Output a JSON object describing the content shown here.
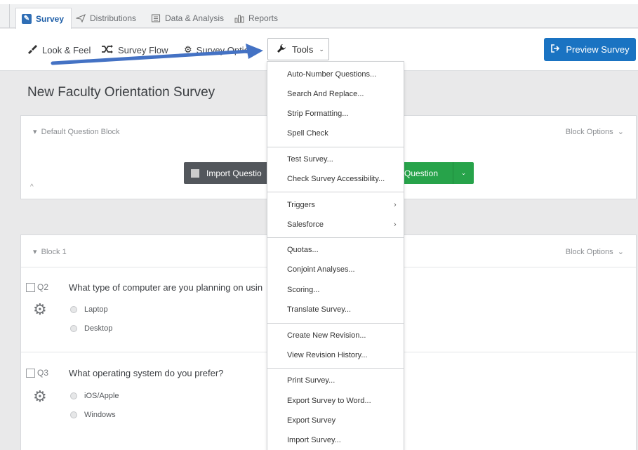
{
  "tabs": [
    {
      "label": "Survey",
      "icon": "pencil-icon",
      "active": true
    },
    {
      "label": "Distributions",
      "icon": "paper-plane-icon"
    },
    {
      "label": "Data & Analysis",
      "icon": "table-icon"
    },
    {
      "label": "Reports",
      "icon": "bar-chart-icon"
    }
  ],
  "toolbar": {
    "look_feel": "Look & Feel",
    "survey_flow": "Survey Flow",
    "survey_options": "Survey Optio",
    "tools": "Tools",
    "preview": "Preview Survey"
  },
  "survey": {
    "title": "New Faculty Orientation Survey",
    "block1": {
      "name": "Default Question Block",
      "options": "Block Options",
      "import_label": "Import Questio",
      "create_label": "Question"
    },
    "block2": {
      "name": "Block 1",
      "options": "Block Options",
      "questions": [
        {
          "num": "Q2",
          "text": "What type of computer are you planning on usin",
          "choices": [
            "Laptop",
            "Desktop"
          ]
        },
        {
          "num": "Q3",
          "text": "What operating system do you prefer?",
          "choices": [
            "iOS/Apple",
            "Windows"
          ]
        }
      ]
    }
  },
  "menu": {
    "items": [
      "Auto-Number Questions...",
      "Search And Replace...",
      "Strip Formatting...",
      "Spell Check",
      "Test Survey...",
      "Check Survey Accessibility...",
      "Triggers",
      "Salesforce",
      "Quotas...",
      "Conjoint Analyses...",
      "Scoring...",
      "Translate Survey...",
      "Create New Revision...",
      "View Revision History...",
      "Print Survey...",
      "Export Survey to Word...",
      "Export Survey",
      "Import Survey..."
    ]
  },
  "colors": {
    "accent": "#1a73c2",
    "create_green": "#27a34a",
    "annotation_arrow": "#4472c4"
  }
}
